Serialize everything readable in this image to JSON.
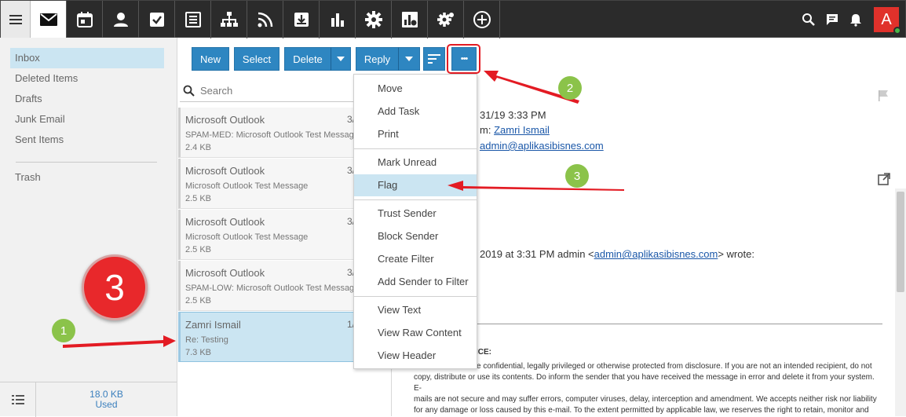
{
  "topbar": {
    "menu_icon": "hamburger-icon",
    "apps": [
      {
        "name": "mail",
        "icon": "envelope-icon",
        "active": true
      },
      {
        "name": "calendar",
        "icon": "calendar-icon"
      },
      {
        "name": "contacts",
        "icon": "person-icon"
      },
      {
        "name": "tasks",
        "icon": "checkbox-icon"
      },
      {
        "name": "notes",
        "icon": "notes-icon"
      },
      {
        "name": "groups",
        "icon": "org-chart-icon"
      },
      {
        "name": "rss",
        "icon": "rss-icon"
      },
      {
        "name": "archive",
        "icon": "download-box-icon"
      },
      {
        "name": "reports",
        "icon": "bar-chart-icon"
      },
      {
        "name": "settings",
        "icon": "gear-icon"
      },
      {
        "name": "stats",
        "icon": "chart-gear-icon"
      },
      {
        "name": "admin",
        "icon": "gears-icon"
      },
      {
        "name": "add",
        "icon": "plus-circle-icon"
      }
    ],
    "right_icons": [
      "search-icon",
      "chat-icon",
      "bell-icon"
    ],
    "avatar_letter": "A"
  },
  "sidebar": {
    "folders": [
      {
        "label": "Inbox",
        "active": true
      },
      {
        "label": "Deleted Items"
      },
      {
        "label": "Drafts"
      },
      {
        "label": "Junk Email"
      },
      {
        "label": "Sent Items"
      }
    ],
    "trash_label": "Trash",
    "quota_size": "18.0 KB",
    "quota_label": "Used"
  },
  "toolbar": {
    "new_label": "New",
    "select_label": "Select",
    "delete_label": "Delete",
    "reply_label": "Reply",
    "more_label": "•••"
  },
  "list": {
    "search_placeholder": "Search",
    "messages": [
      {
        "from": "Microsoft Outlook",
        "date": "3/",
        "subject": "SPAM-MED: Microsoft Outlook Test Message",
        "size": "2.4 KB"
      },
      {
        "from": "Microsoft Outlook",
        "date": "3/",
        "subject": "Microsoft Outlook Test Message",
        "size": "2.5 KB"
      },
      {
        "from": "Microsoft Outlook",
        "date": "3/",
        "subject": "Microsoft Outlook Test Message",
        "size": "2.5 KB"
      },
      {
        "from": "Microsoft Outlook",
        "date": "3/",
        "subject": "SPAM-LOW: Microsoft Outlook Test Message",
        "size": "2.5 KB"
      },
      {
        "from": "Zamri Ismail",
        "date": "1/",
        "subject": "Re: Testing",
        "size": "7.3 KB",
        "selected": true
      }
    ]
  },
  "reading": {
    "date": "31/19 3:33 PM",
    "from_prefix": "m:",
    "from_name": "Zamri Ismail",
    "to_email": "admin@aplikasibisnes.com",
    "quote_prefix": "2019 at 3:31 PM admin <",
    "quote_email": "admin@aplikasibisnes.com",
    "quote_suffix": "> wrote:",
    "notice_title": "ICE:",
    "disclaimer_1": "e confidential, legally privileged or otherwise protected from disclosure. If you are not an intended recipient, do not",
    "disclaimer_2": "copy, distribute or use its contents. Do inform the sender that you have received the message in error and delete it from your system. E-",
    "disclaimer_3": "mails are not secure and may suffer errors, computer viruses, delay, interception and amendment. We accepts neither risk nor liability",
    "disclaimer_4": "for any damage or loss caused by this e-mail. To the extent permitted by applicable law, we reserves the right to retain, monitor and"
  },
  "more_menu": {
    "group1": [
      "Move",
      "Add Task",
      "Print"
    ],
    "group2": [
      "Mark Unread",
      "Flag"
    ],
    "group3": [
      "Trust Sender",
      "Block Sender",
      "Create Filter",
      "Add Sender to Filter"
    ],
    "group4": [
      "View Text",
      "View Raw Content",
      "View Header"
    ],
    "highlighted": "Flag"
  },
  "annotations": {
    "step1": "1",
    "step2": "2",
    "step3": "3",
    "big_step": "3"
  },
  "colors": {
    "button_blue": "#2e86c1",
    "selection": "#cbe5f2",
    "annotation_green": "#8bc34a",
    "arrow_red": "#e31b23",
    "avatar_red": "#e0312b"
  }
}
